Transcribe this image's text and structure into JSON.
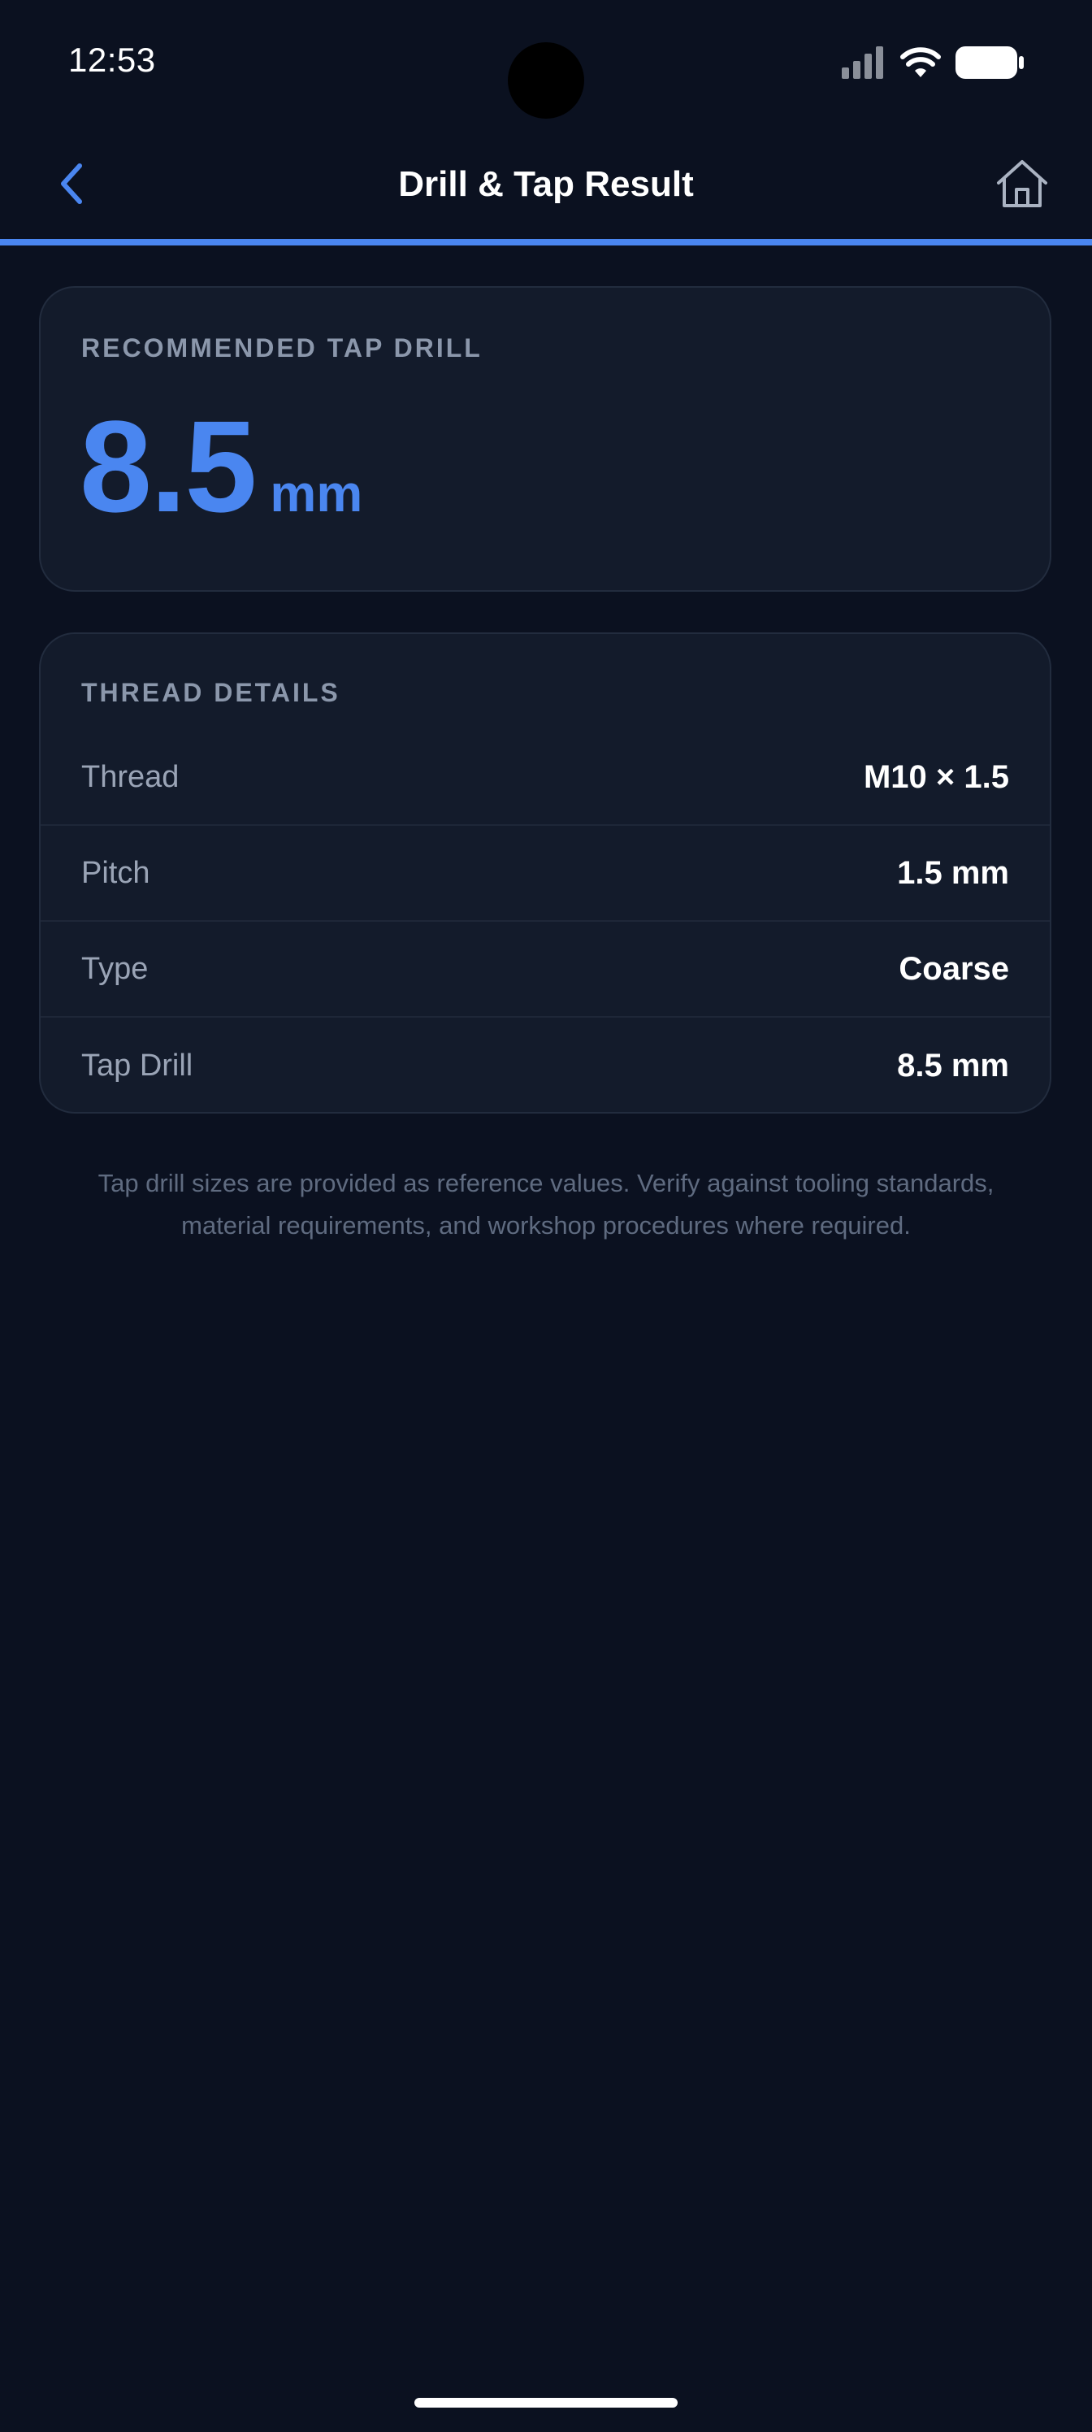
{
  "status_bar": {
    "time": "12:53",
    "icons": [
      "cellular-signal-icon",
      "wifi-icon",
      "battery-icon"
    ]
  },
  "header": {
    "title": "Drill & Tap Result",
    "back_icon": "chevron-left-icon",
    "home_icon": "home-icon"
  },
  "result": {
    "label": "RECOMMENDED TAP DRILL",
    "value": "8.5",
    "unit": "mm"
  },
  "details": {
    "label": "THREAD DETAILS",
    "rows": [
      {
        "label": "Thread",
        "value": "M10 × 1.5"
      },
      {
        "label": "Pitch",
        "value": "1.5 mm"
      },
      {
        "label": "Type",
        "value": "Coarse"
      },
      {
        "label": "Tap Drill",
        "value": "8.5 mm"
      }
    ]
  },
  "disclaimer": "Tap drill sizes are provided as reference values. Verify against tooling standards, material requirements, and workshop procedures where required.",
  "colors": {
    "background": "#0b1120",
    "card": "#131b2b",
    "accent": "#4a86f0",
    "muted_text": "#8b97ab"
  }
}
